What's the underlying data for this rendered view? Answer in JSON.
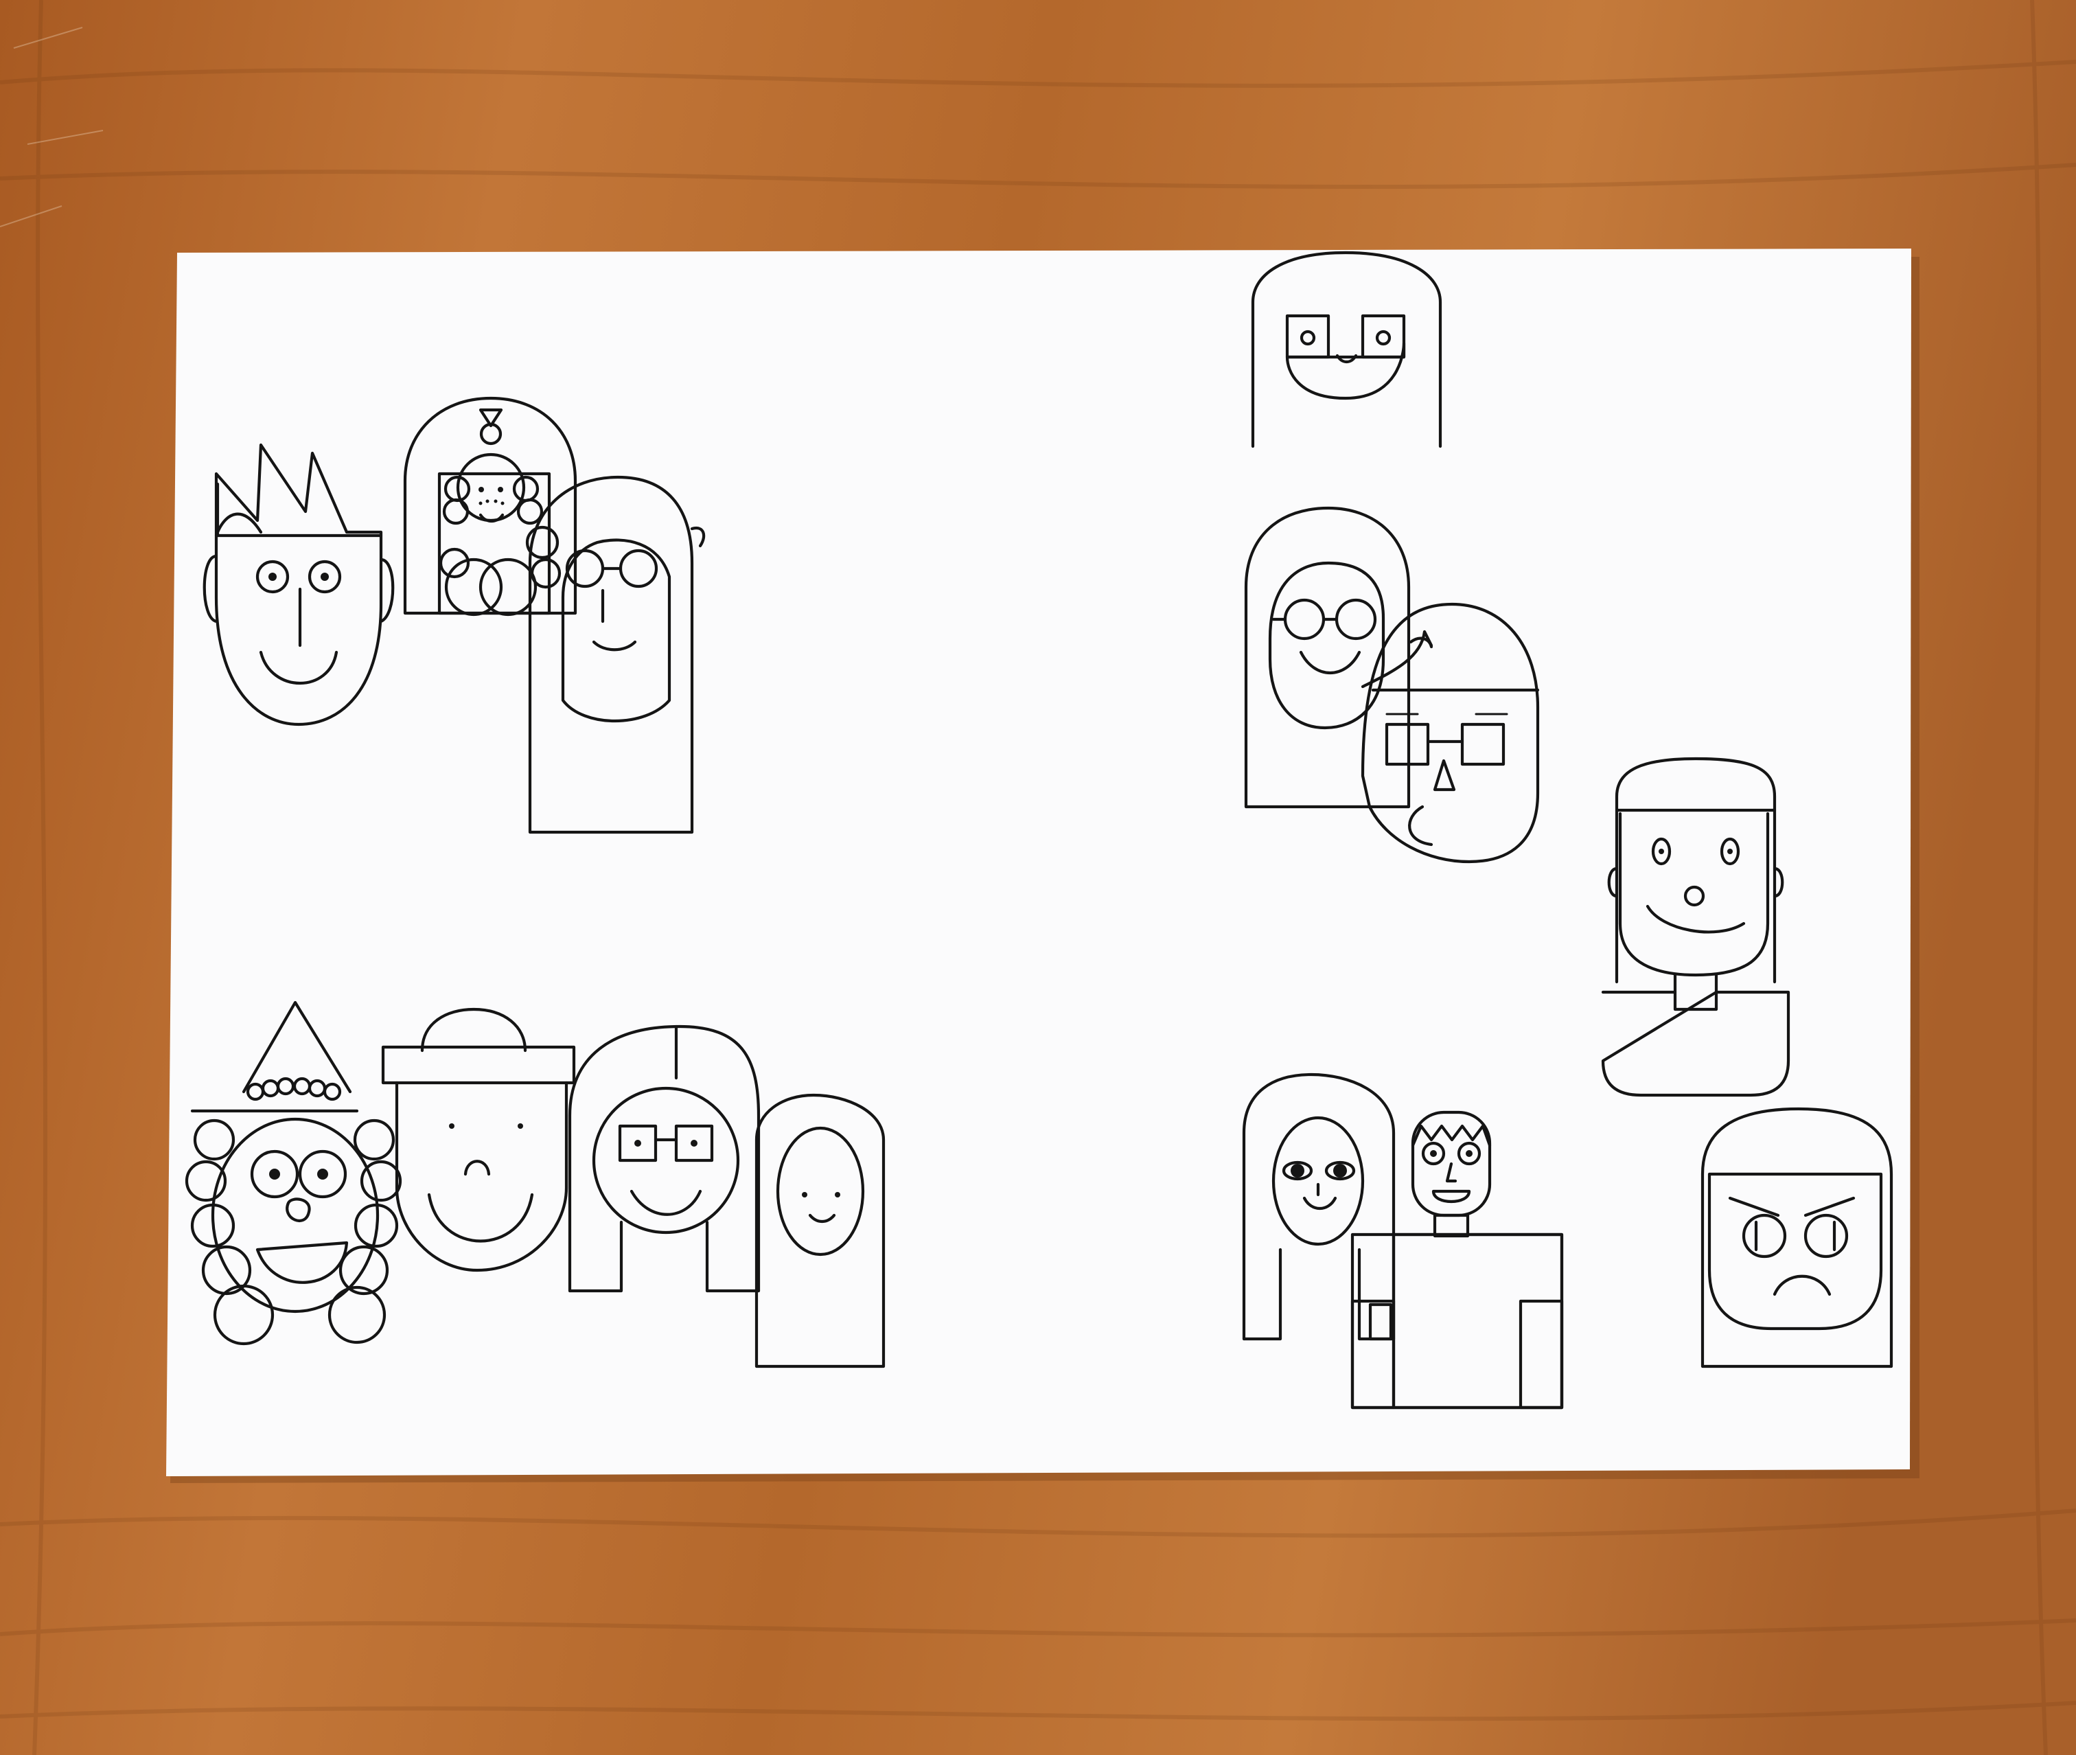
{
  "scene": {
    "subject": "",
    "colors": {
      "table_base": "#b5662a",
      "table_light": "#c97b3c",
      "table_dark": "#8f4a1c",
      "paper": "#fbfbfc",
      "ink": "#151515"
    }
  },
  "figures": [
    {
      "id": "spiky-hair-man",
      "group": "top-left"
    },
    {
      "id": "framed-portrait",
      "group": "top-left"
    },
    {
      "id": "glasses-long-hair",
      "group": "top-left"
    },
    {
      "id": "arched-hair-smile",
      "group": "top-right"
    },
    {
      "id": "round-glasses-woman",
      "group": "right-middle"
    },
    {
      "id": "square-glasses-man",
      "group": "right-middle"
    },
    {
      "id": "bob-hair-man",
      "group": "right-middle"
    },
    {
      "id": "curly-hat-woman",
      "group": "bottom-left"
    },
    {
      "id": "hat-man",
      "group": "bottom-left"
    },
    {
      "id": "square-glasses-woman",
      "group": "bottom-left"
    },
    {
      "id": "oval-face-long-hair",
      "group": "bottom-left"
    },
    {
      "id": "long-hair-woman",
      "group": "bottom-right"
    },
    {
      "id": "zigzag-hair-boy",
      "group": "bottom-right"
    },
    {
      "id": "angry-face",
      "group": "bottom-right"
    }
  ]
}
